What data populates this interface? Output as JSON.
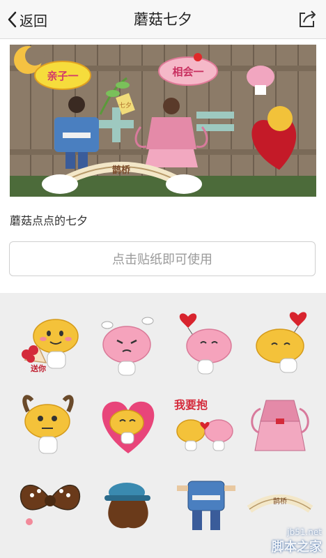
{
  "nav": {
    "back_label": "返回",
    "title": "蘑菇七夕"
  },
  "hero": {
    "sign_left": "亲子一",
    "sign_right": "相会一",
    "tag": "七夕",
    "bridge": "鹊桥"
  },
  "content": {
    "caption": "蘑菇点点的七夕",
    "use_button": "点击贴纸即可使用"
  },
  "stickers": [
    {
      "name": "flower-bouquet-sticker",
      "text": "送你"
    },
    {
      "name": "pink-angry-sticker"
    },
    {
      "name": "pink-heart-balloon-sticker"
    },
    {
      "name": "yellow-heart-balloon-sticker"
    },
    {
      "name": "ox-horns-sticker"
    },
    {
      "name": "pink-heart-sticker"
    },
    {
      "name": "kiss-sticker",
      "text": "我要抱"
    },
    {
      "name": "pink-dress-sticker"
    },
    {
      "name": "bow-sticker"
    },
    {
      "name": "blue-hat-sticker"
    },
    {
      "name": "blue-outfit-sticker"
    },
    {
      "name": "bridge-sticker",
      "text": "鹊桥"
    }
  ],
  "watermark": {
    "site": "jb51.net",
    "brand": "脚本之家"
  }
}
